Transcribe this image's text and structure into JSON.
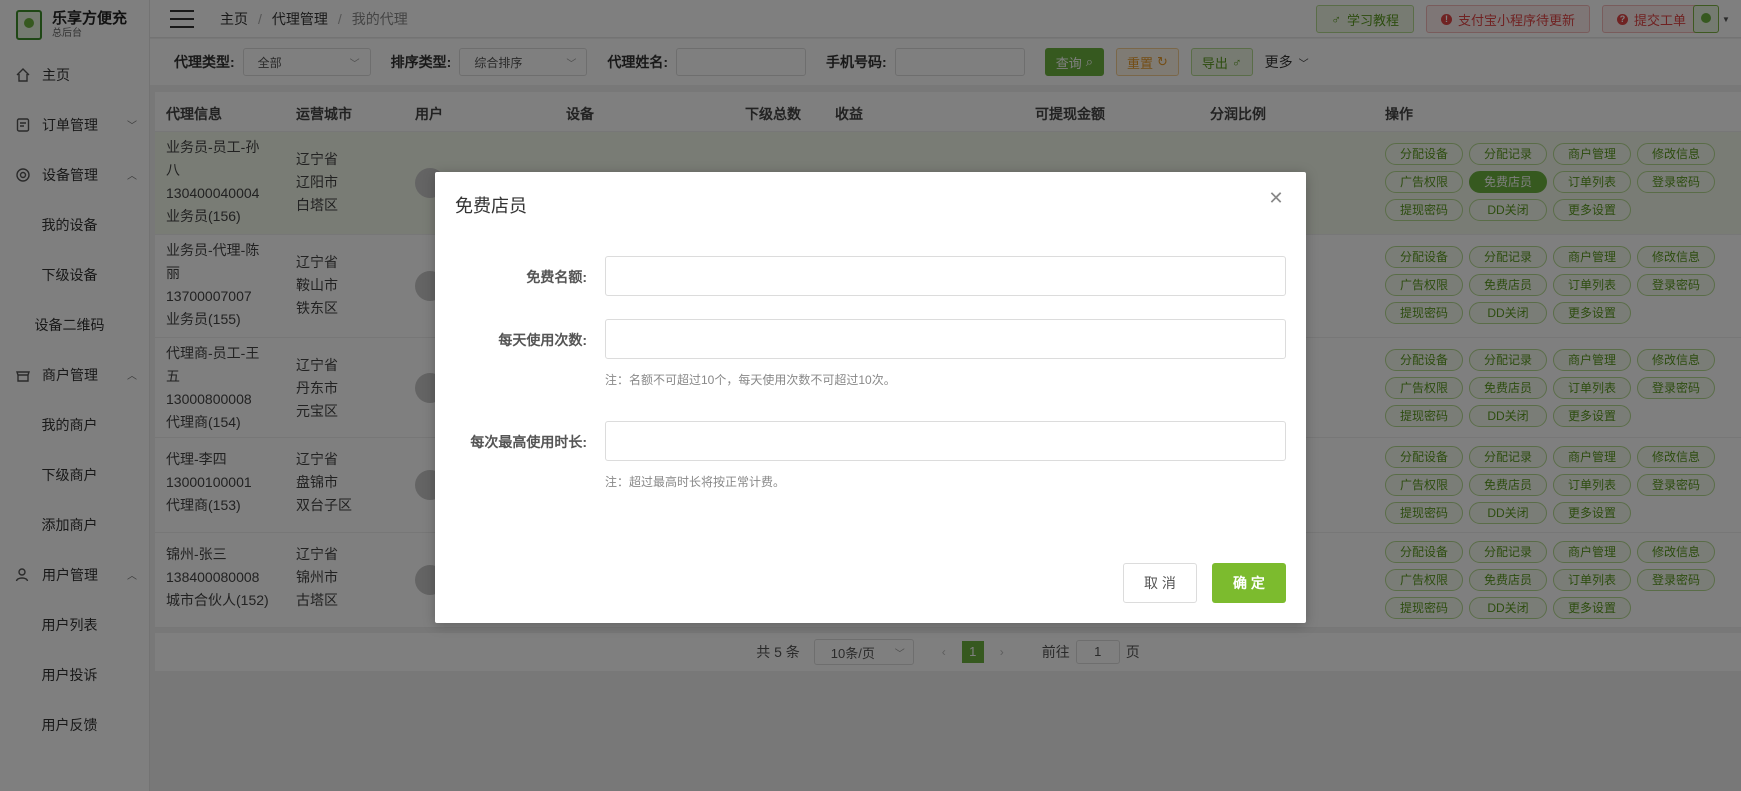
{
  "app": {
    "title": "乐享方便充",
    "subtitle": "总后台"
  },
  "sidebar": {
    "items": [
      {
        "label": "主页",
        "icon": "home-icon"
      },
      {
        "label": "订单管理",
        "icon": "order-icon"
      },
      {
        "label": "设备管理",
        "icon": "device-icon"
      },
      {
        "label": "我的设备"
      },
      {
        "label": "下级设备"
      },
      {
        "label": "设备二维码"
      },
      {
        "label": "商户管理",
        "icon": "shop-icon"
      },
      {
        "label": "我的商户"
      },
      {
        "label": "下级商户"
      },
      {
        "label": "添加商户"
      },
      {
        "label": "用户管理",
        "icon": "user-icon"
      },
      {
        "label": "用户列表"
      },
      {
        "label": "用户投诉"
      },
      {
        "label": "用户反馈"
      }
    ]
  },
  "breadcrumb": [
    "主页",
    "代理管理",
    "我的代理"
  ],
  "top_buttons": {
    "tutorial": "学习教程",
    "alipay_notice": "支付宝小程序待更新",
    "ticket": "提交工单"
  },
  "filters": {
    "agent_type_label": "代理类型:",
    "agent_type_value": "全部",
    "sort_type_label": "排序类型:",
    "sort_type_value": "综合排序",
    "agent_name_label": "代理姓名:",
    "phone_label": "手机号码:",
    "query": "查询",
    "reset": "重置",
    "export": "导出",
    "more": "更多"
  },
  "table": {
    "headers": [
      "代理信息",
      "运营城市",
      "用户",
      "设备",
      "下级总数",
      "收益",
      "可提现金额",
      "分润比例",
      "操作"
    ],
    "rows": [
      {
        "info": [
          "业务员-员工-孙",
          "八",
          "130400040004",
          "业务员(156)"
        ],
        "city": [
          "辽宁省",
          "辽阳市",
          "白塔区"
        ]
      },
      {
        "info": [
          "业务员-代理-陈",
          "丽",
          "13700007007",
          "业务员(155)"
        ],
        "city": [
          "辽宁省",
          "鞍山市",
          "铁东区"
        ]
      },
      {
        "info": [
          "代理商-员工-王",
          "五",
          "13000800008",
          "代理商(154)"
        ],
        "city": [
          "辽宁省",
          "丹东市",
          "元宝区"
        ]
      },
      {
        "info": [
          "代理-李四",
          "13000100001",
          "代理商(153)"
        ],
        "city": [
          "辽宁省",
          "盘锦市",
          "双台子区"
        ]
      },
      {
        "info": [
          "锦州-张三",
          "138400080008",
          "城市合伙人(152)"
        ],
        "city": [
          "辽宁省",
          "锦州市",
          "古塔区"
        ]
      }
    ],
    "ops": [
      "分配设备",
      "分配记录",
      "商户管理",
      "修改信息",
      "广告权限",
      "免费店员",
      "订单列表",
      "登录密码",
      "提现密码",
      "DD关闭",
      "更多设置"
    ]
  },
  "pagination": {
    "total": "共 5 条",
    "page_size": "10条/页",
    "current": "1",
    "goto_prefix": "前往",
    "goto_value": "1",
    "goto_suffix": "页"
  },
  "modal": {
    "title": "免费店员",
    "quota_label": "免费名额:",
    "daily_label": "每天使用次数:",
    "note1": "注：名额不可超过10个，每天使用次数不可超过10次。",
    "max_time_label": "每次最高使用时长:",
    "note2": "注：超过最高时长将按正常计费。",
    "cancel": "取 消",
    "confirm": "确 定"
  },
  "colors": {
    "accent": "#6db33f",
    "confirm": "#7cbb2e",
    "danger": "#e04545"
  }
}
